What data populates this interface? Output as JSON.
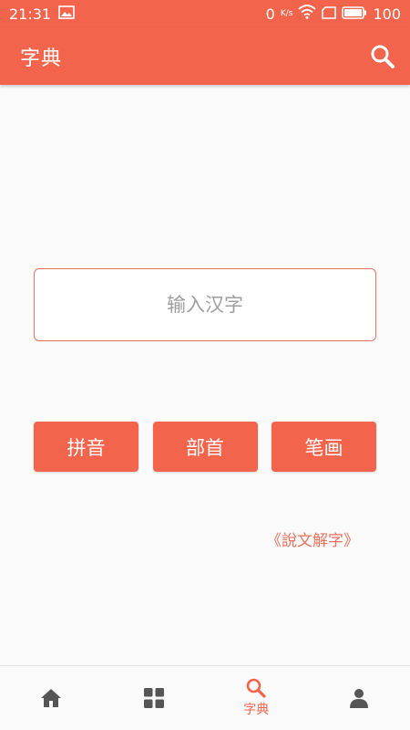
{
  "status": {
    "time": "21:31",
    "image_icon": "image-icon",
    "network_speed": "0",
    "speed_unit": "K/s",
    "wifi_icon": "wifi-icon",
    "sim_icon": "sim-icon",
    "battery_icon": "battery-icon",
    "battery": "100"
  },
  "header": {
    "title": "字典",
    "search_icon": "search-icon"
  },
  "search": {
    "placeholder": "输入汉字",
    "value": ""
  },
  "lookup_buttons": [
    {
      "label": "拼音"
    },
    {
      "label": "部首"
    },
    {
      "label": "笔画"
    }
  ],
  "book_link": "《說文解字》",
  "bottom_nav": [
    {
      "icon": "home-icon",
      "label": ""
    },
    {
      "icon": "grid-icon",
      "label": ""
    },
    {
      "icon": "search-icon",
      "label": "字典",
      "active": true
    },
    {
      "icon": "person-icon",
      "label": ""
    }
  ],
  "colors": {
    "primary": "#f2644c",
    "border": "#e8725c",
    "placeholder": "#9e9e9e",
    "background": "#fafafa"
  }
}
